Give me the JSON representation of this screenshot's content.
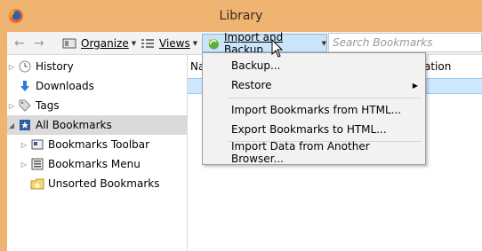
{
  "window": {
    "title": "Library",
    "frame_color": "#f0b472"
  },
  "toolbar": {
    "back_icon": "back-arrow-icon",
    "forward_icon": "forward-arrow-icon",
    "organize_label": "Organize",
    "views_label": "Views",
    "import_backup_label": "Import and Backup",
    "search_placeholder": "Search Bookmarks"
  },
  "sidebar": {
    "items": [
      {
        "label": "History",
        "icon": "clock-icon",
        "twisty": true
      },
      {
        "label": "Downloads",
        "icon": "download-arrow-icon",
        "twisty": false
      },
      {
        "label": "Tags",
        "icon": "tag-icon",
        "twisty": true
      },
      {
        "label": "All Bookmarks",
        "icon": "bookmarks-star-icon",
        "twisty": true,
        "selected": true
      },
      {
        "label": "Bookmarks Toolbar",
        "icon": "bookmarks-toolbar-icon",
        "twisty": true
      },
      {
        "label": "Bookmarks Menu",
        "icon": "bookmarks-menu-icon",
        "twisty": true
      },
      {
        "label": "Unsorted Bookmarks",
        "icon": "unsorted-bookmarks-icon",
        "twisty": false
      }
    ]
  },
  "content": {
    "col_name_fragment": "Na",
    "col_location_fragment": "ation"
  },
  "menu": {
    "items": [
      {
        "label": "Backup...",
        "submenu": false
      },
      {
        "label": "Restore",
        "submenu": true
      },
      {
        "label": "Import Bookmarks from HTML...",
        "submenu": false
      },
      {
        "label": "Export Bookmarks to HTML...",
        "submenu": false
      },
      {
        "label": "Import Data from Another Browser...",
        "submenu": false
      }
    ]
  }
}
